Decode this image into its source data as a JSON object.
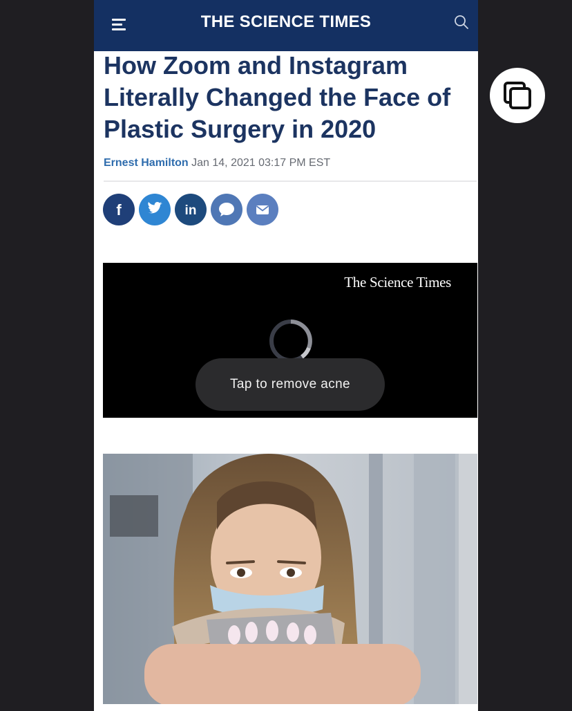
{
  "header": {
    "brand": "THE SCIENCE TIMES",
    "menu_icon": "hamburger-menu-icon",
    "search_icon": "search-icon",
    "background": "#143062"
  },
  "article": {
    "headline": "How Zoom and Instagram Literally Changed the Face of Plastic Surgery in 2020",
    "author": "Ernest Hamilton",
    "date": "Jan 14, 2021 03:17 PM EST"
  },
  "share_buttons": [
    {
      "icon": "facebook-icon",
      "color": "#1f3f78"
    },
    {
      "icon": "twitter-icon",
      "color": "#2f86d3"
    },
    {
      "icon": "linkedin-icon",
      "color": "#1d4a7d"
    },
    {
      "icon": "message-icon",
      "color": "#4f77b5"
    },
    {
      "icon": "email-icon",
      "color": "#5b7fbf"
    }
  ],
  "video": {
    "brand": "The Science Times",
    "toast": "Tap to remove acne"
  },
  "overlay": {
    "copy_icon": "copy-window-icon"
  }
}
